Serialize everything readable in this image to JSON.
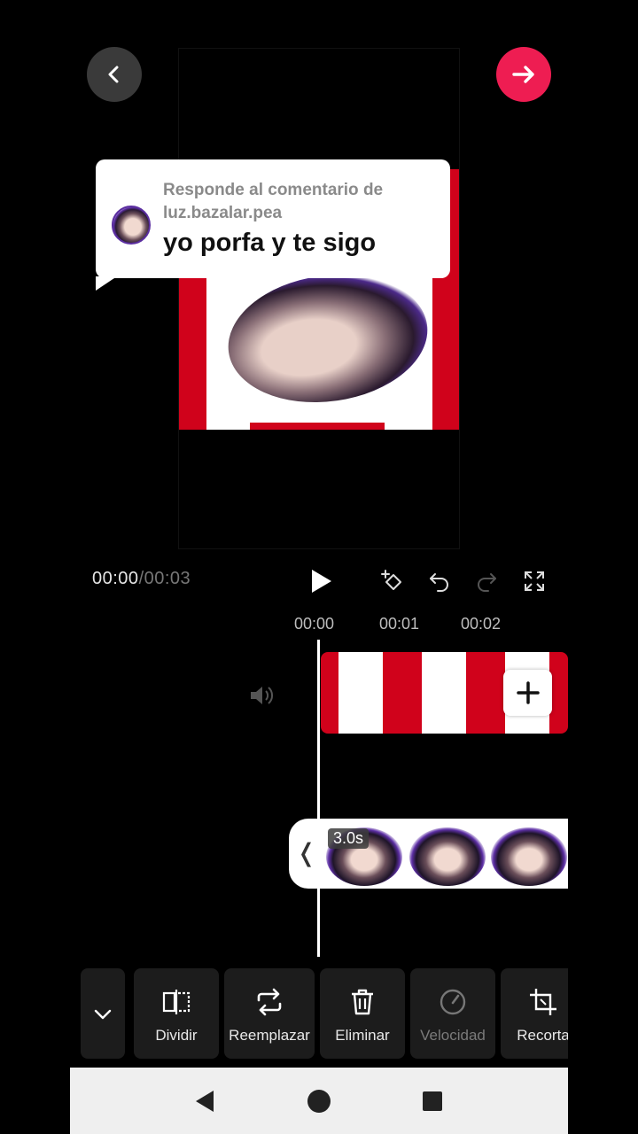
{
  "top": {
    "back_icon": "chevron-left-icon",
    "next_icon": "arrow-right-icon",
    "accent_color": "#ee1d52"
  },
  "comment": {
    "header": "Responde al comentario de luz.bazalar.pea",
    "text": "yo porfa y te sigo"
  },
  "playback": {
    "current_time": "00:00",
    "separator": "/",
    "total_time": "00:03"
  },
  "ruler": [
    "00:00",
    "00:01",
    "00:02"
  ],
  "clip": {
    "duration": "3.0s",
    "handle": "❬"
  },
  "toolbar": {
    "items": [
      {
        "label": "Dividir",
        "icon": "split-icon"
      },
      {
        "label": "Reemplazar",
        "icon": "replace-icon"
      },
      {
        "label": "Eliminar",
        "icon": "trash-icon"
      },
      {
        "label": "Velocidad",
        "icon": "speed-icon",
        "disabled": true
      },
      {
        "label": "Recorta",
        "icon": "crop-icon"
      }
    ]
  }
}
